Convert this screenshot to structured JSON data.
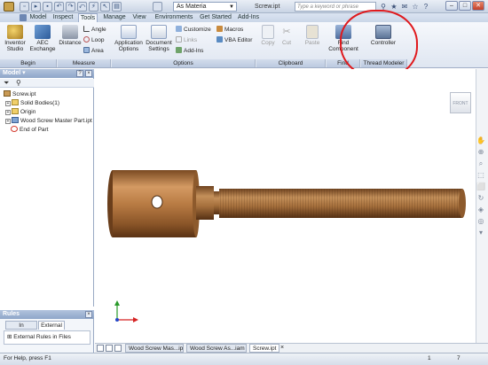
{
  "titlebar": {
    "material": "As Materia",
    "document": "Screw.ipt",
    "search_placeholder": "Type a keyword or phrase",
    "minimize": "–",
    "maximize": "□",
    "close": "✕"
  },
  "tabs": [
    "Model",
    "Inspect",
    "Tools",
    "Manage",
    "View",
    "Environments",
    "Get Started",
    "Add-Ins"
  ],
  "active_tab": "Tools",
  "ribbon": {
    "begin": {
      "inventor_studio": "Inventor Studio",
      "aec_exchange": "AEC Exchange",
      "footer": "Begin"
    },
    "measure": {
      "distance": "Distance",
      "angle": "Angle",
      "loop": "Loop",
      "area": "Area",
      "footer": "Measure"
    },
    "options": {
      "application_options": "Application Options",
      "document_settings": "Document Settings",
      "customize": "Customize",
      "links": "Links",
      "add_ins": "Add-Ins",
      "macros": "Macros",
      "vba_editor": "VBA Editor",
      "footer": "Options"
    },
    "clipboard": {
      "copy": "Copy",
      "cut": "Cut",
      "paste": "Paste",
      "footer": "Clipboard"
    },
    "find": {
      "find_component": "Find Component",
      "footer": "Find"
    },
    "thread_modeler": {
      "controller": "Controller",
      "footer": "Thread Modeler"
    }
  },
  "browser": {
    "title": "Model",
    "tree": [
      {
        "label": "Screw.ipt"
      },
      {
        "label": "Solid Bodies(1)"
      },
      {
        "label": "Origin"
      },
      {
        "label": "Wood Screw Master Part.ipt"
      },
      {
        "label": "End of Part"
      }
    ]
  },
  "rules": {
    "title": "Rules",
    "tabs": [
      "In Document",
      "External"
    ],
    "active_tab": "External",
    "item": "External Rules in Files"
  },
  "viewcube": {
    "face": "FRONT"
  },
  "doc_tabs": [
    "Wood Screw Mas...ipt",
    "Wood Screw As...iam",
    "Screw.ipt"
  ],
  "active_doc_tab": "Screw.ipt",
  "status": {
    "help": "For Help, press F1",
    "count_a": "1",
    "count_b": "7"
  },
  "colors": {
    "annotation": "#e0191d",
    "wood_light": "#c48a52",
    "wood_dark": "#6b3a17"
  }
}
